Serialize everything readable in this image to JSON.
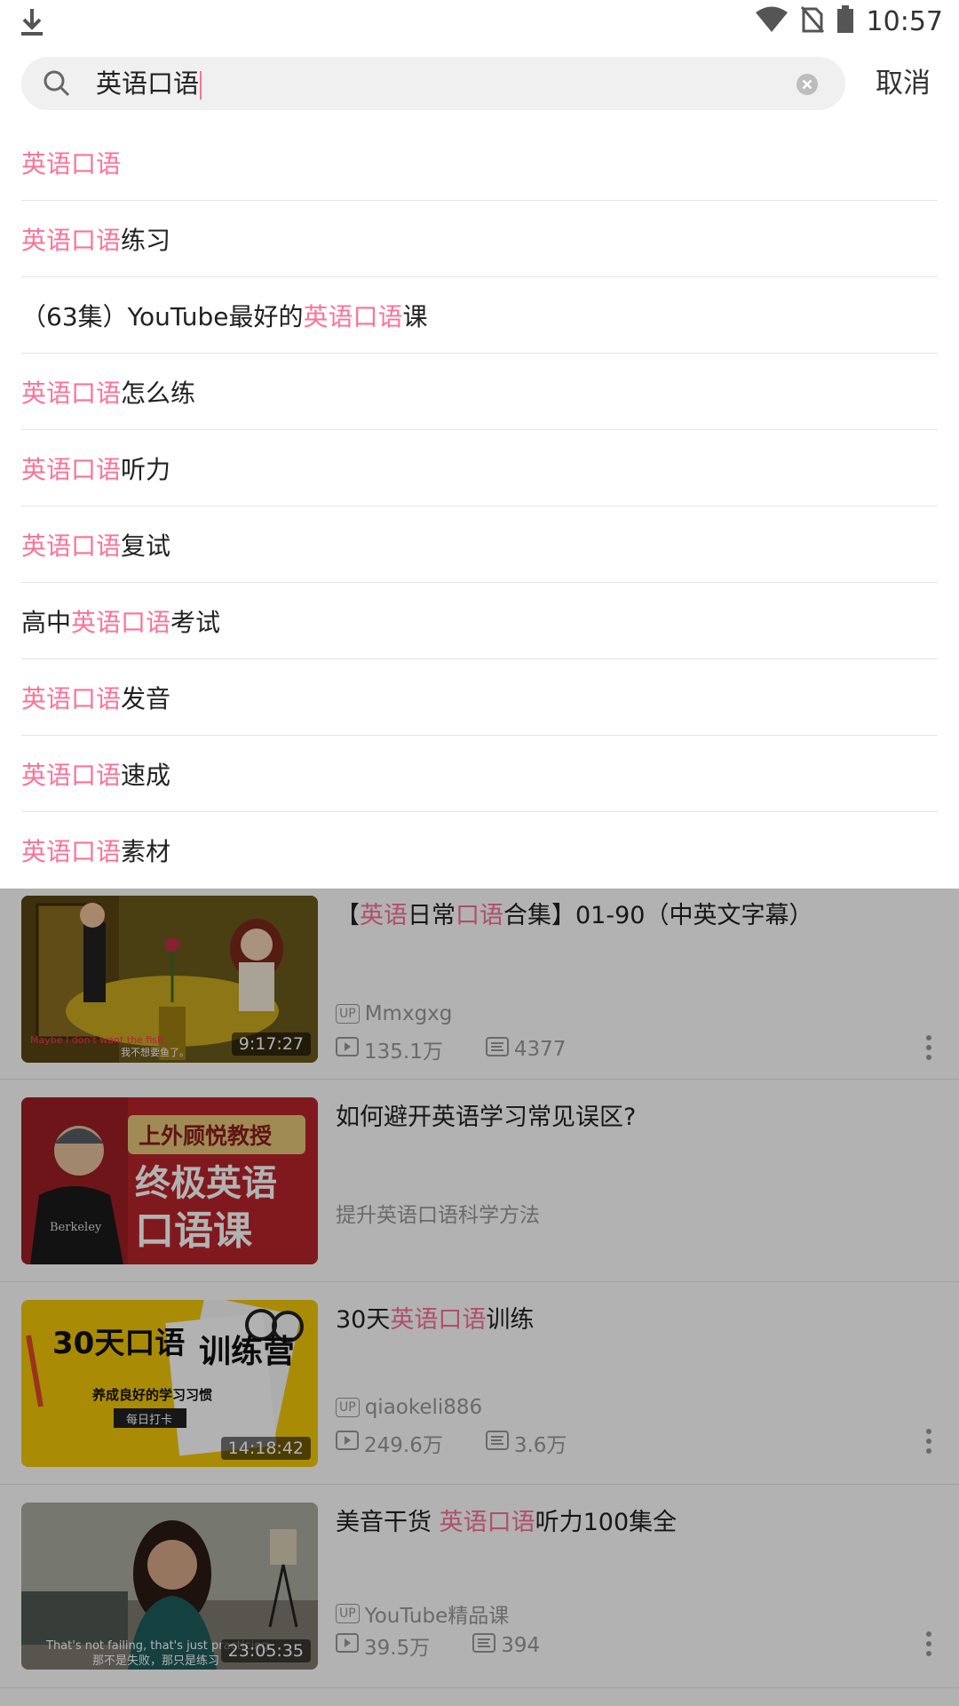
{
  "status_bar": {
    "time": "10:57"
  },
  "search": {
    "query": "英语口语",
    "cancel_label": "取消"
  },
  "suggestions": [
    [
      {
        "t": "英语口语",
        "h": true
      }
    ],
    [
      {
        "t": "英语口语",
        "h": true
      },
      {
        "t": "练习",
        "h": false
      }
    ],
    [
      {
        "t": "（63集）YouTube最好的",
        "h": false
      },
      {
        "t": "英语口语",
        "h": true
      },
      {
        "t": "课",
        "h": false
      }
    ],
    [
      {
        "t": "英语口语",
        "h": true
      },
      {
        "t": "怎么练",
        "h": false
      }
    ],
    [
      {
        "t": "英语口语",
        "h": true
      },
      {
        "t": "听力",
        "h": false
      }
    ],
    [
      {
        "t": "英语口语",
        "h": true
      },
      {
        "t": "复试",
        "h": false
      }
    ],
    [
      {
        "t": "高中",
        "h": false
      },
      {
        "t": "英语口语",
        "h": true
      },
      {
        "t": "考试",
        "h": false
      }
    ],
    [
      {
        "t": "英语口语",
        "h": true
      },
      {
        "t": "发音",
        "h": false
      }
    ],
    [
      {
        "t": "英语口语",
        "h": true
      },
      {
        "t": "速成",
        "h": false
      }
    ],
    [
      {
        "t": "英语口语",
        "h": true
      },
      {
        "t": "素材",
        "h": false
      }
    ]
  ],
  "results": [
    {
      "title_parts": [
        {
          "t": "【",
          "h": false
        },
        {
          "t": "英语",
          "h": true
        },
        {
          "t": "日常",
          "h": false
        },
        {
          "t": "口语",
          "h": true
        },
        {
          "t": "合集】01-90（中英文字幕）",
          "h": false
        }
      ],
      "duration": "9:17:27",
      "uploader": "Mmxgxg",
      "views": "135.1万",
      "danmaku": "4377",
      "thumb_caption_en": "Maybe I don't want the fish.",
      "thumb_caption_cn": "我不想要鱼了。"
    },
    {
      "title": "如何避开英语学习常见误区?",
      "subtitle": "提升英语口语科学方法",
      "thumb_text_1": "上外顾悦教授",
      "thumb_text_2": "终极英语",
      "thumb_text_3": "口语课",
      "thumb_shirt": "Berkeley"
    },
    {
      "title_parts": [
        {
          "t": "30天",
          "h": false
        },
        {
          "t": "英语口语",
          "h": true
        },
        {
          "t": "训练",
          "h": false
        }
      ],
      "duration": "14:18:42",
      "uploader": "qiaokeli886",
      "views": "249.6万",
      "danmaku": "3.6万",
      "thumb_text_1": "30天口语",
      "thumb_text_2": "训练营",
      "thumb_text_3": "养成良好的学习习惯",
      "thumb_text_4": "每日打卡"
    },
    {
      "title_parts": [
        {
          "t": "美音干货 ",
          "h": false
        },
        {
          "t": "英语口语",
          "h": true
        },
        {
          "t": "听力100集全",
          "h": false
        }
      ],
      "duration": "23:05:35",
      "uploader": "YouTube精品课",
      "views": "39.5万",
      "danmaku": "394",
      "thumb_caption_en": "That's not failing, that's just practicing.",
      "thumb_caption_cn": "那不是失败，那只是练习"
    }
  ],
  "labels": {
    "up_badge": "UP"
  },
  "colors": {
    "accent": "#fb7299",
    "text": "#212121",
    "muted": "#999999"
  }
}
